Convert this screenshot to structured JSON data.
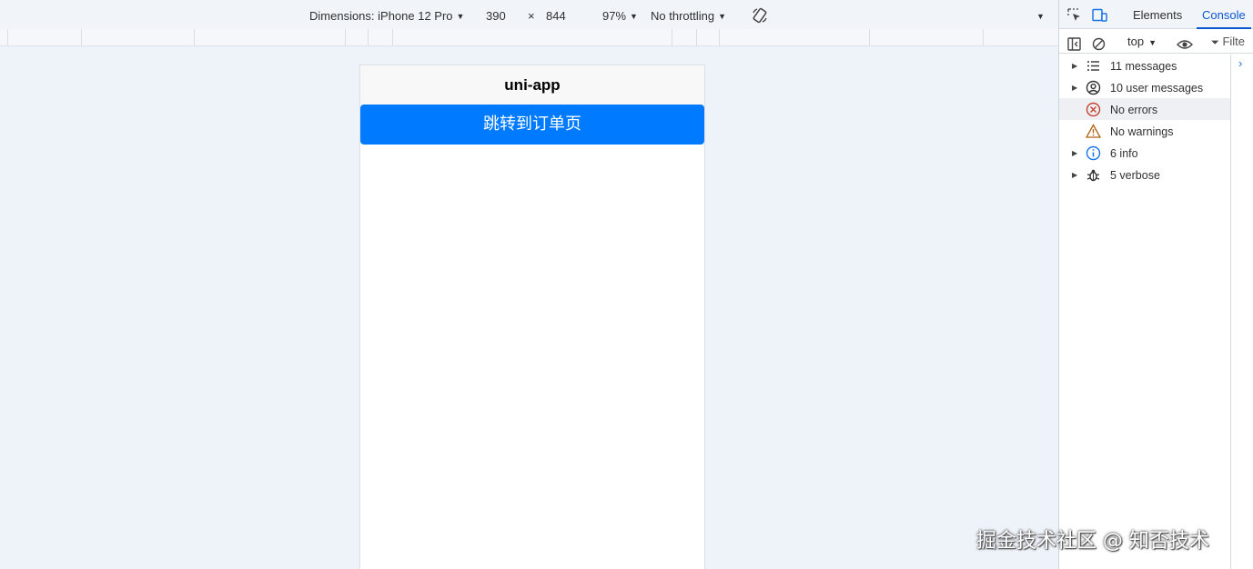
{
  "device_toolbar": {
    "dimensions_label": "Dimensions: iPhone 12 Pro",
    "width": "390",
    "times": "×",
    "height": "844",
    "zoom": "97%",
    "throttling": "No throttling"
  },
  "phone": {
    "nav_title": "uni-app",
    "button_label": "跳转到订单页",
    "button_color": "#007aff"
  },
  "devtools": {
    "tabs": [
      "Elements",
      "Console"
    ],
    "active_tab": "Console",
    "context": "top",
    "filter_placeholder": "Filte",
    "sidebar": [
      {
        "label": "11 messages",
        "icon": "list-icon",
        "expandable": true
      },
      {
        "label": "10 user messages",
        "icon": "user-circle-icon",
        "expandable": true
      },
      {
        "label": "No errors",
        "icon": "error-circle-icon",
        "expandable": false,
        "highlighted": true
      },
      {
        "label": "No warnings",
        "icon": "warning-triangle-icon",
        "expandable": false
      },
      {
        "label": "6 info",
        "icon": "info-circle-icon",
        "expandable": true
      },
      {
        "label": "5 verbose",
        "icon": "bug-icon",
        "expandable": true
      }
    ]
  },
  "watermark": "掘金技术社区 @ 知否技术"
}
